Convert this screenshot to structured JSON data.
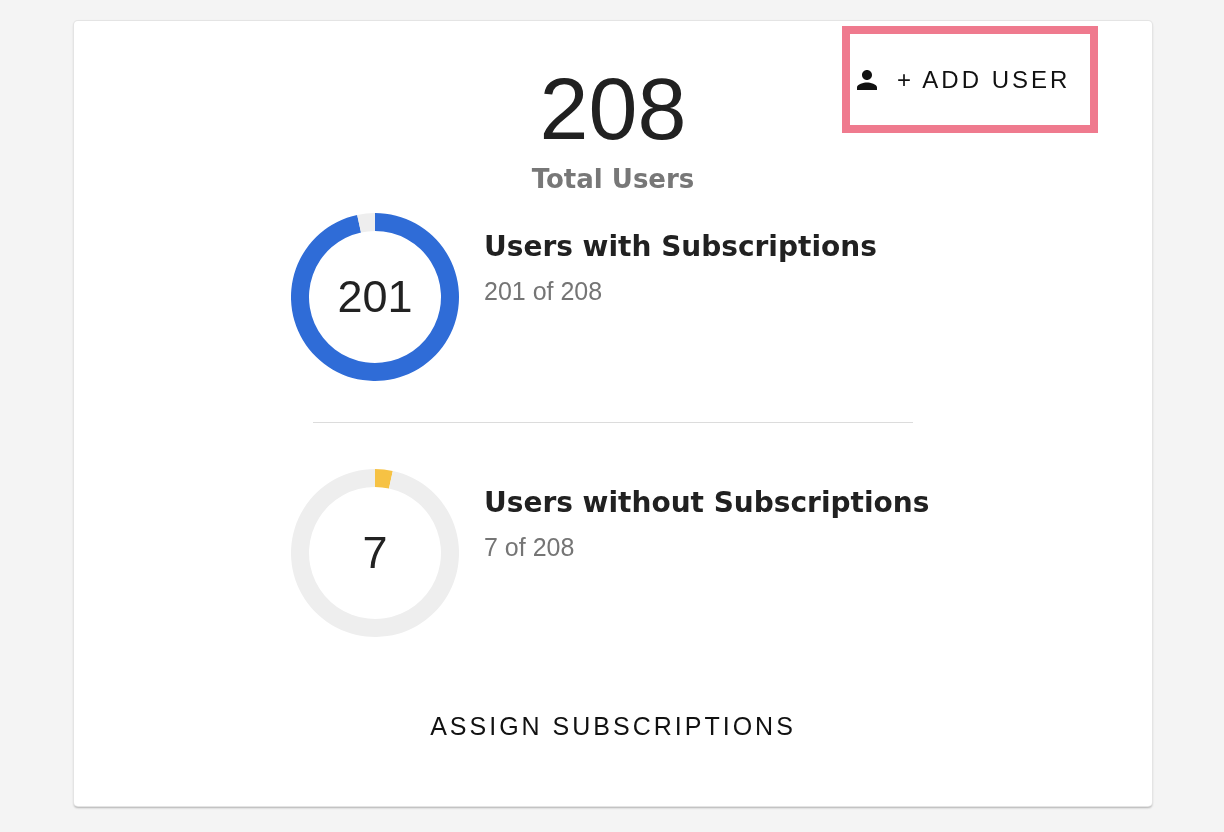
{
  "total": {
    "value": "208",
    "label": "Total Users"
  },
  "add_user_button": {
    "label": "+ ADD USER",
    "highlighted": true
  },
  "stats": [
    {
      "value": "201",
      "title": "Users with Subscriptions",
      "detail": "201 of 208",
      "color": "#2f6cd7",
      "chart_data": {
        "type": "donut",
        "values": [
          96.6,
          3.4
        ]
      }
    },
    {
      "value": "7",
      "title": "Users without Subscriptions",
      "detail": "7 of 208",
      "color": "#f6c244",
      "chart_data": {
        "type": "donut",
        "values": [
          3.4,
          96.6
        ]
      }
    }
  ],
  "assign_button": {
    "label": "ASSIGN SUBSCRIPTIONS"
  }
}
